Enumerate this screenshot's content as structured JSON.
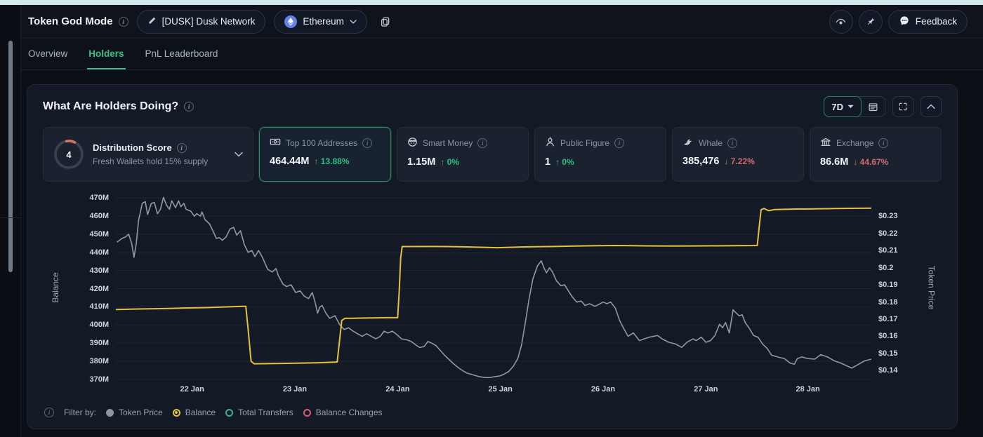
{
  "topbar": {
    "title": "Token God Mode",
    "token_button": "[DUSK] Dusk Network",
    "chain_button": "Ethereum",
    "feedback_label": "Feedback"
  },
  "tabs": [
    {
      "label": "Overview"
    },
    {
      "label": "Holders"
    },
    {
      "label": "PnL Leaderboard"
    }
  ],
  "panel": {
    "title": "What Are Holders Doing?",
    "range": "7D"
  },
  "stats": {
    "distribution": {
      "score": "4",
      "title": "Distribution Score",
      "subtitle": "Fresh Wallets hold 15% supply"
    },
    "cards": [
      {
        "label": "Top 100 Addresses",
        "value": "464.44M",
        "arrow": "↑",
        "change": "13.88%",
        "direction": "up",
        "selected": true
      },
      {
        "label": "Smart Money",
        "value": "1.15M",
        "arrow": "↑",
        "change": "0%",
        "direction": "up",
        "selected": false
      },
      {
        "label": "Public Figure",
        "value": "1",
        "arrow": "↑",
        "change": "0%",
        "direction": "up",
        "selected": false
      },
      {
        "label": "Whale",
        "value": "385,476",
        "arrow": "↓",
        "change": "7.22%",
        "direction": "down",
        "selected": false
      },
      {
        "label": "Exchange",
        "value": "86.6M",
        "arrow": "↓",
        "change": "44.67%",
        "direction": "down",
        "selected": false
      }
    ]
  },
  "legend": {
    "prefix": "Filter by:",
    "items": [
      {
        "label": "Token Price",
        "state": "filled-gray"
      },
      {
        "label": "Balance",
        "state": "selected-yellow"
      },
      {
        "label": "Total Transfers",
        "state": "ring-teal"
      },
      {
        "label": "Balance Changes",
        "state": "ring-pink"
      }
    ]
  },
  "colors": {
    "accent_green": "#2ebd85",
    "red": "#d6696f",
    "balance_line": "#e6c23c",
    "price_line": "#8e99a8",
    "teal": "#3fae98",
    "pink": "#d75c77",
    "eth_blue": "#6481e7",
    "top_strip": "#cfe9ec",
    "grid": "rgba(148,163,184,0.09)"
  },
  "chart_data": {
    "type": "line",
    "title": "What Are Holders Doing?",
    "x_axis": {
      "labels": [
        "22 Jan",
        "23 Jan",
        "24 Jan",
        "25 Jan",
        "26 Jan",
        "27 Jan",
        "28 Jan"
      ],
      "label_fracs": [
        0.101,
        0.237,
        0.373,
        0.509,
        0.645,
        0.781,
        0.916
      ]
    },
    "left_axis": {
      "title": "Balance",
      "min": 370,
      "max": 470,
      "tick_values": [
        470,
        460,
        450,
        440,
        430,
        420,
        410,
        400,
        390,
        380,
        370
      ],
      "tick_labels": [
        "470M",
        "460M",
        "450M",
        "440M",
        "430M",
        "420M",
        "410M",
        "400M",
        "390M",
        "380M",
        "370M"
      ]
    },
    "right_axis": {
      "title": "Token Price",
      "min": 0.14,
      "max": 0.23,
      "tick_values": [
        0.23,
        0.22,
        0.21,
        0.2,
        0.19,
        0.18,
        0.17,
        0.16,
        0.15,
        0.14
      ],
      "tick_labels": [
        "$0.23",
        "$0.22",
        "$0.21",
        "$0.2",
        "$0.19",
        "$0.18",
        "$0.17",
        "$0.16",
        "$0.15",
        "$0.14"
      ]
    },
    "series": [
      {
        "name": "Token Price",
        "axis": "right",
        "color": "#8e99a8",
        "points": [
          [
            0.002,
            0.215
          ],
          [
            0.008,
            0.217
          ],
          [
            0.013,
            0.218
          ],
          [
            0.017,
            0.2195
          ],
          [
            0.021,
            0.214
          ],
          [
            0.024,
            0.206
          ],
          [
            0.027,
            0.214
          ],
          [
            0.03,
            0.2275
          ],
          [
            0.035,
            0.2375
          ],
          [
            0.039,
            0.2385
          ],
          [
            0.042,
            0.231
          ],
          [
            0.047,
            0.2375
          ],
          [
            0.051,
            0.238
          ],
          [
            0.055,
            0.2315
          ],
          [
            0.059,
            0.234
          ],
          [
            0.063,
            0.241
          ],
          [
            0.067,
            0.2365
          ],
          [
            0.071,
            0.234
          ],
          [
            0.074,
            0.239
          ],
          [
            0.079,
            0.235
          ],
          [
            0.083,
            0.239
          ],
          [
            0.086,
            0.2355
          ],
          [
            0.09,
            0.2375
          ],
          [
            0.093,
            0.234
          ],
          [
            0.099,
            0.233
          ],
          [
            0.104,
            0.23
          ],
          [
            0.107,
            0.2315
          ],
          [
            0.112,
            0.23
          ],
          [
            0.114,
            0.2325
          ],
          [
            0.118,
            0.228
          ],
          [
            0.124,
            0.2255
          ],
          [
            0.129,
            0.221
          ],
          [
            0.133,
            0.217
          ],
          [
            0.137,
            0.2175
          ],
          [
            0.141,
            0.216
          ],
          [
            0.146,
            0.218
          ],
          [
            0.151,
            0.2225
          ],
          [
            0.156,
            0.2235
          ],
          [
            0.16,
            0.219
          ],
          [
            0.165,
            0.2215
          ],
          [
            0.17,
            0.2135
          ],
          [
            0.175,
            0.209
          ],
          [
            0.18,
            0.21
          ],
          [
            0.184,
            0.2065
          ],
          [
            0.189,
            0.21
          ],
          [
            0.194,
            0.206
          ],
          [
            0.201,
            0.199
          ],
          [
            0.207,
            0.1975
          ],
          [
            0.212,
            0.1995
          ],
          [
            0.215,
            0.1955
          ],
          [
            0.221,
            0.1905
          ],
          [
            0.226,
            0.189
          ],
          [
            0.232,
            0.19
          ],
          [
            0.238,
            0.1855
          ],
          [
            0.244,
            0.1865
          ],
          [
            0.249,
            0.1835
          ],
          [
            0.255,
            0.182
          ],
          [
            0.26,
            0.1855
          ],
          [
            0.264,
            0.1795
          ],
          [
            0.267,
            0.1735
          ],
          [
            0.27,
            0.177
          ],
          [
            0.273,
            0.178
          ],
          [
            0.278,
            0.1735
          ],
          [
            0.283,
            0.1705
          ],
          [
            0.29,
            0.172
          ],
          [
            0.296,
            0.167
          ],
          [
            0.302,
            0.164
          ],
          [
            0.308,
            0.165
          ],
          [
            0.314,
            0.163
          ],
          [
            0.32,
            0.1615
          ],
          [
            0.326,
            0.16
          ],
          [
            0.332,
            0.1615
          ],
          [
            0.338,
            0.16
          ],
          [
            0.344,
            0.1585
          ],
          [
            0.35,
            0.16
          ],
          [
            0.355,
            0.163
          ],
          [
            0.36,
            0.162
          ],
          [
            0.366,
            0.163
          ],
          [
            0.372,
            0.161
          ],
          [
            0.378,
            0.1585
          ],
          [
            0.385,
            0.158
          ],
          [
            0.391,
            0.157
          ],
          [
            0.397,
            0.155
          ],
          [
            0.402,
            0.1535
          ],
          [
            0.408,
            0.154
          ],
          [
            0.413,
            0.157
          ],
          [
            0.418,
            0.156
          ],
          [
            0.424,
            0.1545
          ],
          [
            0.43,
            0.1515
          ],
          [
            0.435,
            0.149
          ],
          [
            0.441,
            0.1465
          ],
          [
            0.447,
            0.144
          ],
          [
            0.454,
            0.1415
          ],
          [
            0.459,
            0.14
          ],
          [
            0.465,
            0.1385
          ],
          [
            0.473,
            0.1375
          ],
          [
            0.481,
            0.1365
          ],
          [
            0.488,
            0.136
          ],
          [
            0.495,
            0.136
          ],
          [
            0.502,
            0.1365
          ],
          [
            0.509,
            0.137
          ],
          [
            0.514,
            0.138
          ],
          [
            0.52,
            0.1395
          ],
          [
            0.526,
            0.1425
          ],
          [
            0.532,
            0.147
          ],
          [
            0.537,
            0.155
          ],
          [
            0.542,
            0.168
          ],
          [
            0.547,
            0.182
          ],
          [
            0.552,
            0.1935
          ],
          [
            0.558,
            0.201
          ],
          [
            0.563,
            0.204
          ],
          [
            0.567,
            0.1995
          ],
          [
            0.57,
            0.197
          ],
          [
            0.574,
            0.2
          ],
          [
            0.578,
            0.1975
          ],
          [
            0.583,
            0.1925
          ],
          [
            0.589,
            0.1895
          ],
          [
            0.594,
            0.19
          ],
          [
            0.599,
            0.1865
          ],
          [
            0.604,
            0.183
          ],
          [
            0.61,
            0.18
          ],
          [
            0.616,
            0.1805
          ],
          [
            0.621,
            0.178
          ],
          [
            0.627,
            0.179
          ],
          [
            0.634,
            0.1775
          ],
          [
            0.639,
            0.1785
          ],
          [
            0.645,
            0.18
          ],
          [
            0.65,
            0.179
          ],
          [
            0.655,
            0.18
          ],
          [
            0.661,
            0.1765
          ],
          [
            0.667,
            0.169
          ],
          [
            0.673,
            0.164
          ],
          [
            0.678,
            0.16
          ],
          [
            0.685,
            0.162
          ],
          [
            0.693,
            0.1575
          ],
          [
            0.699,
            0.1585
          ],
          [
            0.706,
            0.1595
          ],
          [
            0.717,
            0.1605
          ],
          [
            0.723,
            0.1585
          ],
          [
            0.732,
            0.1565
          ],
          [
            0.741,
            0.1555
          ],
          [
            0.749,
            0.1535
          ],
          [
            0.756,
            0.1565
          ],
          [
            0.764,
            0.1585
          ],
          [
            0.768,
            0.1575
          ],
          [
            0.775,
            0.1595
          ],
          [
            0.781,
            0.1565
          ],
          [
            0.787,
            0.1575
          ],
          [
            0.793,
            0.1605
          ],
          [
            0.799,
            0.167
          ],
          [
            0.803,
            0.165
          ],
          [
            0.807,
            0.168
          ],
          [
            0.812,
            0.162
          ],
          [
            0.817,
            0.1755
          ],
          [
            0.82,
            0.174
          ],
          [
            0.825,
            0.172
          ],
          [
            0.829,
            0.1725
          ],
          [
            0.833,
            0.168
          ],
          [
            0.838,
            0.165
          ],
          [
            0.844,
            0.1605
          ],
          [
            0.85,
            0.1595
          ],
          [
            0.856,
            0.1555
          ],
          [
            0.862,
            0.153
          ],
          [
            0.868,
            0.149
          ],
          [
            0.876,
            0.148
          ],
          [
            0.885,
            0.147
          ],
          [
            0.892,
            0.1445
          ],
          [
            0.898,
            0.1437
          ],
          [
            0.902,
            0.147
          ],
          [
            0.908,
            0.148
          ],
          [
            0.916,
            0.147
          ],
          [
            0.925,
            0.1467
          ],
          [
            0.933,
            0.1493
          ],
          [
            0.942,
            0.148
          ],
          [
            0.951,
            0.1457
          ],
          [
            0.959,
            0.1445
          ],
          [
            0.968,
            0.1427
          ],
          [
            0.974,
            0.1415
          ],
          [
            0.983,
            0.1437
          ],
          [
            0.991,
            0.1457
          ],
          [
            1.0,
            0.1467
          ]
        ]
      },
      {
        "name": "Balance",
        "axis": "left",
        "color": "#e6c23c",
        "points": [
          [
            0.0,
            408.5
          ],
          [
            0.03,
            408.8
          ],
          [
            0.06,
            409.0
          ],
          [
            0.09,
            409.3
          ],
          [
            0.12,
            409.6
          ],
          [
            0.15,
            410.0
          ],
          [
            0.168,
            410.3
          ],
          [
            0.172,
            410.3
          ],
          [
            0.175,
            398
          ],
          [
            0.179,
            380
          ],
          [
            0.183,
            378.6
          ],
          [
            0.21,
            378.7
          ],
          [
            0.24,
            378.9
          ],
          [
            0.27,
            379.2
          ],
          [
            0.29,
            379.5
          ],
          [
            0.293,
            379.6
          ],
          [
            0.296,
            391
          ],
          [
            0.299,
            402.5
          ],
          [
            0.303,
            403.6
          ],
          [
            0.33,
            403.8
          ],
          [
            0.36,
            404.0
          ],
          [
            0.373,
            404.0
          ],
          [
            0.375,
            418
          ],
          [
            0.377,
            437
          ],
          [
            0.379,
            443.2
          ],
          [
            0.42,
            443.3
          ],
          [
            0.46,
            443.1
          ],
          [
            0.505,
            442.6
          ],
          [
            0.54,
            443.0
          ],
          [
            0.58,
            443.3
          ],
          [
            0.62,
            443.6
          ],
          [
            0.66,
            443.8
          ],
          [
            0.7,
            443.6
          ],
          [
            0.74,
            443.5
          ],
          [
            0.78,
            443.6
          ],
          [
            0.82,
            443.7
          ],
          [
            0.849,
            443.8
          ],
          [
            0.851,
            452
          ],
          [
            0.854,
            463.5
          ],
          [
            0.858,
            464.2
          ],
          [
            0.864,
            463.0
          ],
          [
            0.872,
            463.6
          ],
          [
            0.9,
            463.9
          ],
          [
            0.94,
            464.1
          ],
          [
            0.97,
            464.3
          ],
          [
            1.0,
            464.4
          ]
        ]
      }
    ]
  }
}
